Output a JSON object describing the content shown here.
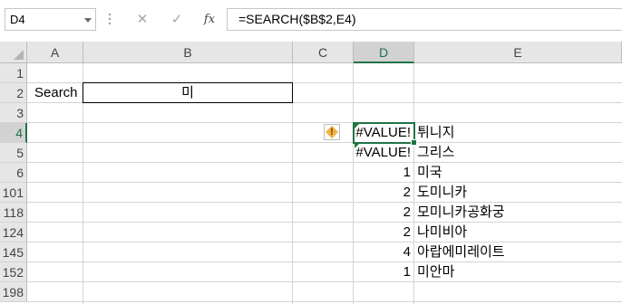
{
  "formula_bar": {
    "name_box": "D4",
    "cancel_symbol": "✕",
    "enter_symbol": "✓",
    "fx_label": "fx",
    "formula": "=SEARCH($B$2,E4)"
  },
  "grid": {
    "selected_cell": "D4",
    "columns": [
      "A",
      "B",
      "C",
      "D",
      "E"
    ],
    "rows": [
      "1",
      "2",
      "3",
      "4",
      "5",
      "6",
      "101",
      "118",
      "124",
      "145",
      "152",
      "198"
    ],
    "cells": {
      "A2": "Search",
      "B2": "미",
      "D4": "#VALUE!",
      "E4": "튀니지",
      "D5": "#VALUE!",
      "E5": "그리스",
      "D6": "1",
      "E6": "미국",
      "D101": "2",
      "E101": "도미니카",
      "D118": "2",
      "E118": "모미니카공화궁",
      "D124": "2",
      "E124": "나미비아",
      "D145": "4",
      "E145": "아랍에미레이트",
      "D152": "1",
      "E152": "미안마"
    },
    "colors": {
      "accent": "#217346",
      "warning": "#f0b44a"
    },
    "error_icon": "warning-diamond-icon"
  }
}
